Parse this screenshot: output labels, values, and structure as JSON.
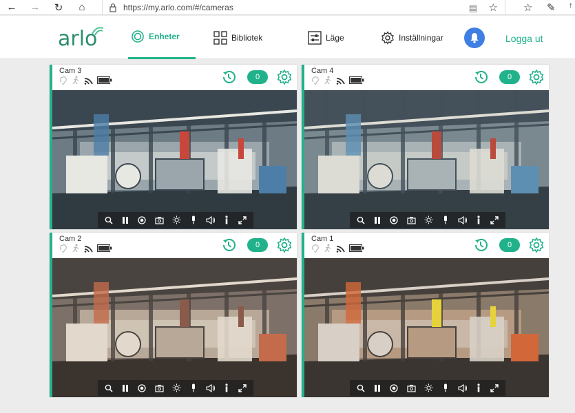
{
  "browser": {
    "url": "https://my.arlo.com/#/cameras"
  },
  "app": {
    "logo": "arlo",
    "nav": [
      {
        "label": "Enheter",
        "icon": "devices-icon",
        "active": true
      },
      {
        "label": "Bibliotek",
        "icon": "library-grid-icon",
        "active": false
      },
      {
        "label": "Läge",
        "icon": "mode-sliders-icon",
        "active": false
      },
      {
        "label": "Inställningar",
        "icon": "settings-gear-icon",
        "active": false
      }
    ],
    "logout": "Logga ut",
    "accent": "#22b28b",
    "bell_color": "#3f7fe3"
  },
  "cameras": [
    {
      "name": "Cam 3",
      "count": "0"
    },
    {
      "name": "Cam 4",
      "count": "0"
    },
    {
      "name": "Cam 2",
      "count": "0"
    },
    {
      "name": "Cam 1",
      "count": "0"
    }
  ],
  "controls": [
    "zoom-icon",
    "pause-icon",
    "record-icon",
    "snapshot-icon",
    "brightness-icon",
    "microphone-icon",
    "speaker-icon",
    "person-icon",
    "fullscreen-icon"
  ]
}
